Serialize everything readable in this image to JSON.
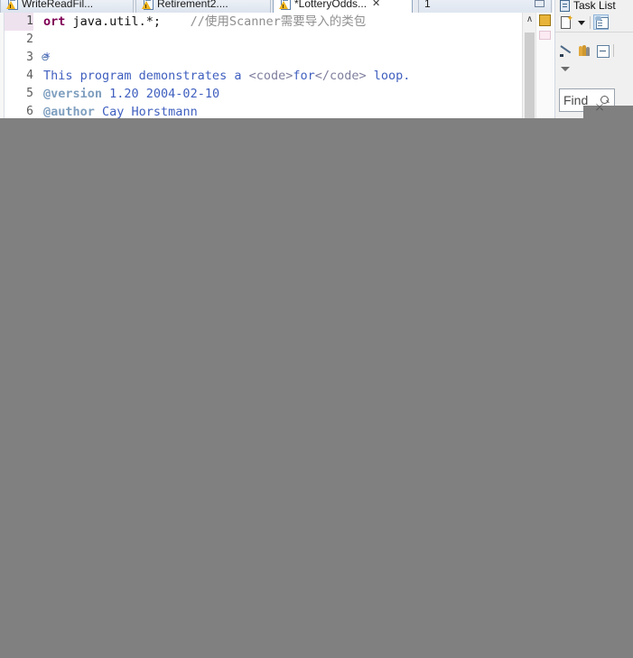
{
  "editor": {
    "tabs": [
      {
        "label": "WriteReadFil...",
        "icon": "java-file-warning-icon",
        "state": "inactive",
        "dirty": false,
        "closeable": false
      },
      {
        "label": "Retirement2....",
        "icon": "java-file-warning-icon",
        "state": "inactive",
        "dirty": false,
        "closeable": false
      },
      {
        "label": "*LotteryOdds...",
        "icon": "java-file-warning-icon",
        "state": "active",
        "dirty": true,
        "closeable": true,
        "close_glyph": "✕"
      },
      {
        "label": "1",
        "icon": "none",
        "state": "plain",
        "dirty": false,
        "closeable": false
      }
    ],
    "restore_button_title": "Restore",
    "code": {
      "lines": [
        {
          "number": "1",
          "current": true,
          "fold": "",
          "segments": [
            {
              "text": "ort",
              "style": "kw"
            },
            {
              "text": " java.util.*;    ",
              "style": "plain"
            },
            {
              "text": "//使用Scanner需要导入的类包",
              "style": "cmt"
            }
          ]
        },
        {
          "number": "2",
          "current": false,
          "fold": "",
          "segments": [
            {
              "text": "",
              "style": "plain"
            }
          ]
        },
        {
          "number": "3",
          "current": false,
          "fold": "⊖",
          "segments": [
            {
              "text": "*",
              "style": "doc"
            }
          ]
        },
        {
          "number": "4",
          "current": false,
          "fold": "",
          "segments": [
            {
              "text": "This program demonstrates a ",
              "style": "doc"
            },
            {
              "text": "<code>",
              "style": "dochtml"
            },
            {
              "text": "for",
              "style": "doc"
            },
            {
              "text": "</code>",
              "style": "dochtml"
            },
            {
              "text": " loop.",
              "style": "doc"
            }
          ]
        },
        {
          "number": "5",
          "current": false,
          "fold": "",
          "segments": [
            {
              "text": "@version",
              "style": "doctag"
            },
            {
              "text": " 1.20 2004-02-10",
              "style": "doc"
            }
          ]
        },
        {
          "number": "6",
          "current": false,
          "fold": "",
          "segments": [
            {
              "text": "@author",
              "style": "doctag"
            },
            {
              "text": " Cay Horstmann",
              "style": "doc"
            }
          ]
        }
      ]
    },
    "scrollbar": {
      "up_arrow_glyph": "∧"
    },
    "overview_ruler": {
      "markers": [
        {
          "name": "warning-marker",
          "color": "#e8b53a"
        },
        {
          "name": "occurrence-marker",
          "color": "#fbeaf2"
        }
      ]
    }
  },
  "task_list": {
    "title": "Task List",
    "toolbar_row1": [
      {
        "name": "new-task-button",
        "label": "New Task"
      },
      {
        "name": "new-task-dropdown-arrow",
        "label": "New Task Menu"
      },
      {
        "name": "categorize-button",
        "label": "Categorize"
      }
    ],
    "toolbar_row2": [
      {
        "name": "focus-on-workweek-button",
        "label": "Focus on Workweek"
      },
      {
        "name": "show-all-people-button",
        "label": "Show All"
      },
      {
        "name": "collapse-all-button",
        "label": "Collapse All"
      }
    ],
    "toolbar_row3": [
      {
        "name": "view-menu-button",
        "label": "View Menu"
      }
    ],
    "find": {
      "value": "Find",
      "placeholder": "Find",
      "icon": "search-icon"
    }
  },
  "overlay": {
    "name": "gray-occluder",
    "color": "#808080"
  }
}
